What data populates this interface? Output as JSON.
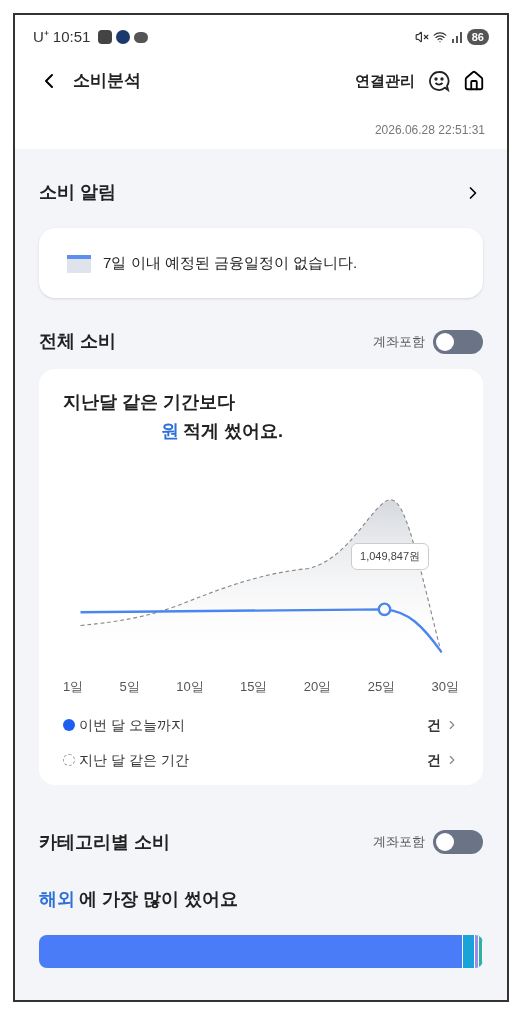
{
  "status_bar": {
    "carrier": "U⁺",
    "time": "10:51",
    "battery": "86"
  },
  "header": {
    "title": "소비분석",
    "action": "연결관리"
  },
  "timestamp": "2026.06.28 22:51:31",
  "alerts": {
    "title": "소비 알림",
    "message": "7일 이내 예정된 금융일정이 없습니다."
  },
  "total": {
    "title": "전체 소비",
    "toggle_label": "계좌포함",
    "toggle_on": false,
    "headline_1": "지난달 같은 기간보다",
    "amount": "원",
    "headline_2": "적게 썼어요.",
    "tooltip": "1,049,847원",
    "x_labels": [
      "1일",
      "5일",
      "10일",
      "15일",
      "20일",
      "25일",
      "30일"
    ],
    "legend": [
      {
        "kind": "current",
        "label": "이번 달 오늘까지",
        "count": "건"
      },
      {
        "kind": "previous",
        "label": "지난 달 같은 기간",
        "count": "건"
      }
    ]
  },
  "category": {
    "title": "카테고리별 소비",
    "toggle_label": "계좌포함",
    "toggle_on": false,
    "top": "해외",
    "headline": "에 가장 많이 썼어요",
    "segments": [
      {
        "kind": "main",
        "color": "#4a7cf7"
      },
      {
        "kind": "minor",
        "color": "#1aa3d9"
      },
      {
        "kind": "tiny",
        "color": "#9b8cf2"
      },
      {
        "kind": "tiny",
        "color": "#2bb3a0"
      }
    ]
  }
}
